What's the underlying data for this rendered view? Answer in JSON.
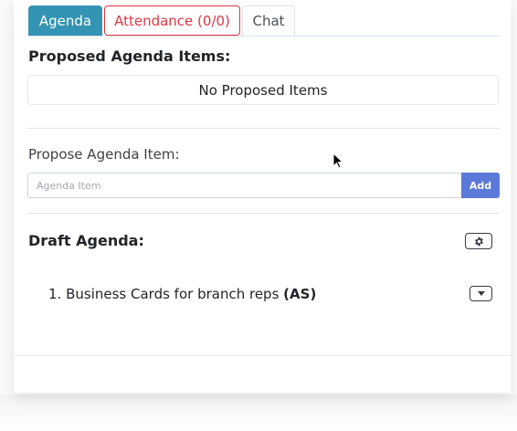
{
  "tabs": [
    {
      "label": "Agenda",
      "active": true
    },
    {
      "label": "Attendance (0/0)",
      "active": false
    },
    {
      "label": "Chat",
      "active": false
    }
  ],
  "proposed": {
    "title": "Proposed Agenda Items:",
    "empty_text": "No Proposed Items"
  },
  "propose_form": {
    "label": "Propose Agenda Item:",
    "input_value": "",
    "placeholder": "Agenda Item",
    "add_label": "Add"
  },
  "draft": {
    "title": "Draft Agenda:",
    "items": [
      {
        "number": "1.",
        "text": "Business Cards for branch reps",
        "owner": "(AS)"
      }
    ]
  },
  "icons": {
    "settings": "gear-icon",
    "item_menu": "caret-down-icon"
  },
  "colors": {
    "active_tab": "#3494b3",
    "attendance_tab": "#dc3545",
    "add_button": "#5b79d9"
  }
}
